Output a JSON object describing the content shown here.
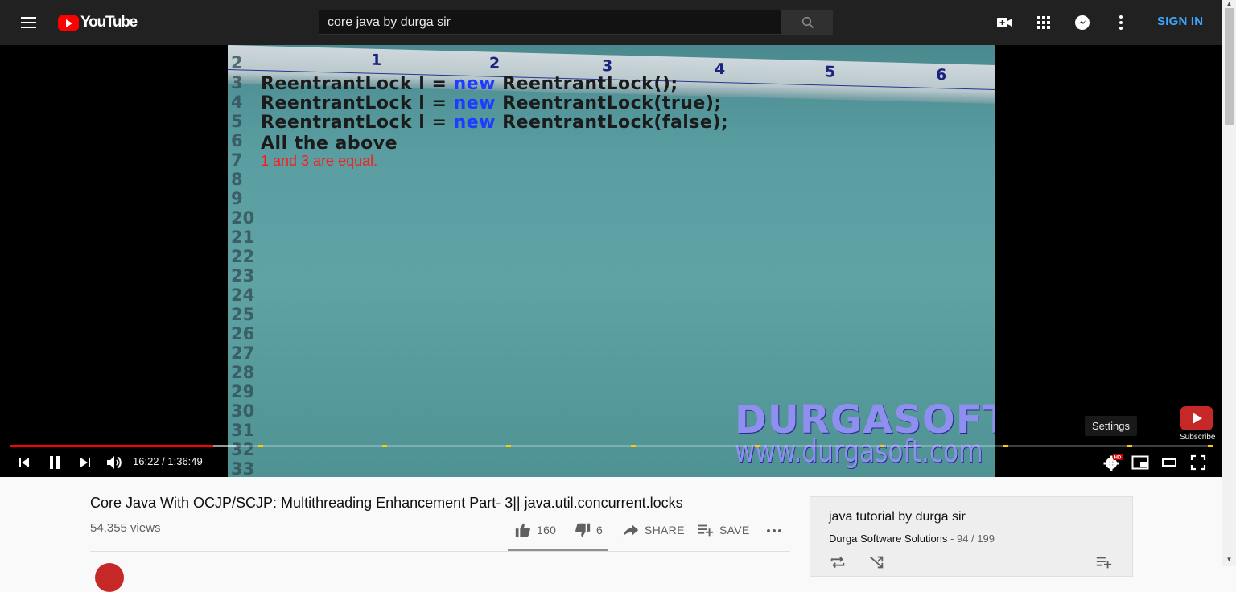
{
  "header": {
    "logo_text": "YouTube",
    "search_value": "core java by durga sir",
    "sign_in_label": "SIGN IN",
    "icons": [
      "menu-icon",
      "search-icon",
      "create-video-icon",
      "apps-icon",
      "messages-icon",
      "more-vert-icon"
    ]
  },
  "video_frame": {
    "ruler_numbers": [
      "1",
      "2",
      "3",
      "4",
      "5",
      "6"
    ],
    "line_numbers": [
      "2",
      "3",
      "4",
      "5",
      "6",
      "7",
      "8",
      "9",
      "20",
      "21",
      "22",
      "23",
      "24",
      "25",
      "26",
      "27",
      "28",
      "29",
      "30",
      "31",
      "32",
      "33"
    ],
    "code": {
      "line1_a": "ReentrantLock l = ",
      "line1_kw": "new",
      "line1_b": " ReentrantLock();",
      "line2_a": "ReentrantLock l = ",
      "line2_kw": "new",
      "line2_b": " ReentrantLock(true);",
      "line3_a": "ReentrantLock l = ",
      "line3_kw": "new",
      "line3_b": " ReentrantLock(false);",
      "line4": "All the above"
    },
    "note": "1 and 3 are equal.",
    "watermark_line1": "DURGASOFT",
    "watermark_line2": "www.durgasoft.com"
  },
  "player": {
    "subscribe_label": "Subscribe",
    "tooltip": "Settings",
    "time_display": "16:22 / 1:36:49",
    "progress_fraction": 0.169,
    "buffered_fraction": 0.188,
    "hd_badge": "HD",
    "colors": {
      "progress": "#ff0000",
      "chapter_marker": "#ffcc00"
    }
  },
  "video_info": {
    "title": "Core Java With OCJP/SCJP: Multithreading Enhancement Part- 3|| java.util.concurrent.locks",
    "views": "54,355 views",
    "likes": "160",
    "dislikes": "6",
    "share_label": "SHARE",
    "save_label": "SAVE",
    "like_fraction": 0.964
  },
  "playlist": {
    "title": "java tutorial by durga sir",
    "channel": "Durga Software Solutions",
    "position": "- 94 / 199"
  }
}
